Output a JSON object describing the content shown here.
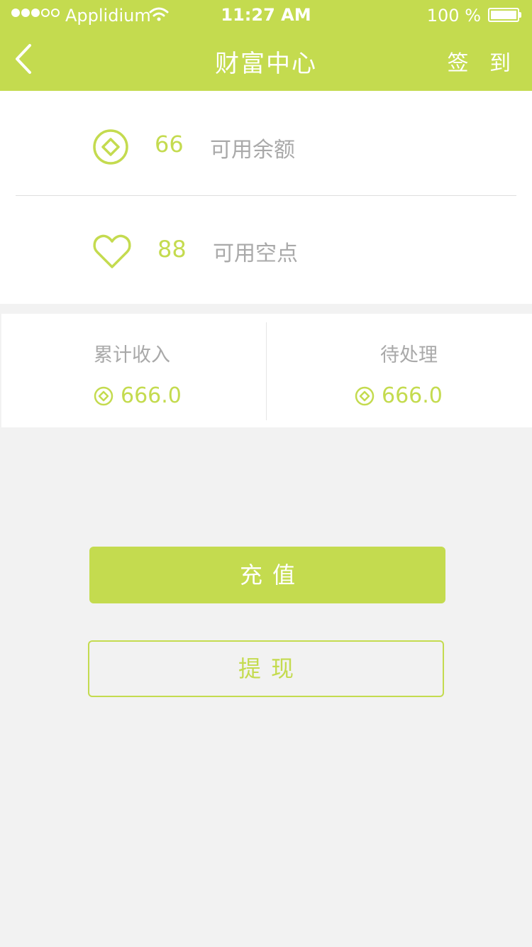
{
  "status_bar": {
    "carrier": "Applidium",
    "time": "11:27 AM",
    "battery": "100 %"
  },
  "nav": {
    "title": "财富中心",
    "checkin_label": "签 到"
  },
  "balance": {
    "amount": "66",
    "amount_label": "可用余额",
    "points": "88",
    "points_label": "可用空点"
  },
  "stats": {
    "income_label": "累计收入",
    "income_value": "666.0",
    "pending_label": "待处理",
    "pending_value": "666.0"
  },
  "actions": {
    "recharge_label": "充值",
    "withdraw_label": "提现"
  },
  "theme": {
    "accent": "#c4db4f",
    "background": "#f2f2f2",
    "muted_text": "#a9a9a9"
  },
  "icons": {
    "back": "chevron-left-icon",
    "coin": "coin-diamond-icon",
    "heart": "heart-icon",
    "wifi": "wifi-icon",
    "battery": "battery-icon"
  }
}
